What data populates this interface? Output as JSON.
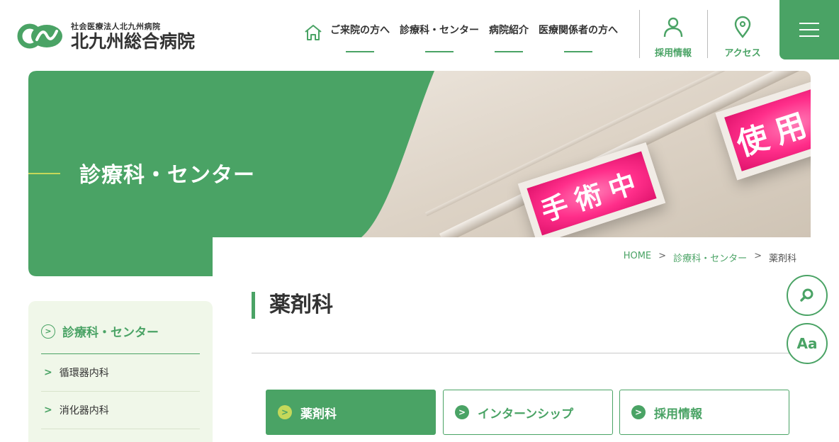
{
  "header": {
    "logo_sub": "社会医療法人北九州病院",
    "logo_main": "北九州総合病院",
    "nav": [
      "ご来院の方へ",
      "診療科・センター",
      "病院紹介",
      "医療関係者の方へ"
    ],
    "recruit_label": "採用情報",
    "access_label": "アクセス"
  },
  "hero": {
    "title": "診療科・センター",
    "sign_left": "手術中",
    "sign_right": "使用中"
  },
  "breadcrumb": {
    "home": "HOME",
    "sep": ">",
    "category": "診療科・センター",
    "current": "薬剤科"
  },
  "page": {
    "title": "薬剤科"
  },
  "fab": {
    "text_size_label": "Aa"
  },
  "sidebar": {
    "heading": "診療科・センター",
    "items": [
      "循環器内科",
      "消化器内科"
    ]
  },
  "tabs": [
    "薬剤科",
    "インターンシップ",
    "採用情報"
  ],
  "colors": {
    "accent": "#4aa365",
    "accent_light": "#c5d85a",
    "sidebar_bg": "#f0f7e9"
  }
}
